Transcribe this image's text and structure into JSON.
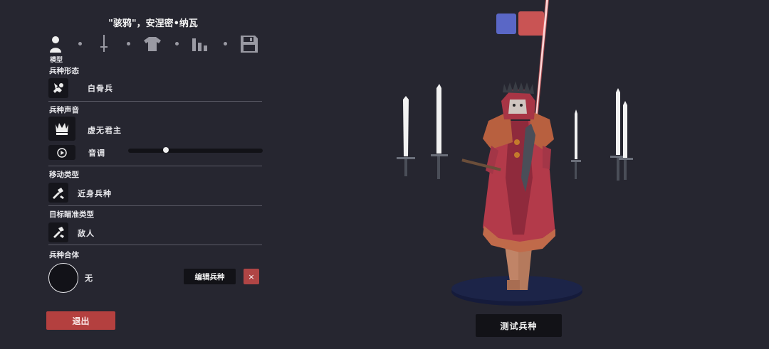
{
  "header": {
    "unit_name": "\"骇鸦\"，安涅密•纳瓦"
  },
  "tabs": {
    "active_label": "模型",
    "items": [
      {
        "icon": "person-icon"
      },
      {
        "icon": "sword-icon"
      },
      {
        "icon": "shirt-icon"
      },
      {
        "icon": "stats-bars-icon"
      },
      {
        "icon": "save-disk-icon"
      }
    ]
  },
  "sections": {
    "unit_base": {
      "label": "兵种形态",
      "value": "白骨兵",
      "icon": "skeleton-icon"
    },
    "unit_voice": {
      "label": "兵种声音",
      "value": "虚无君主",
      "icon": "crown-icon",
      "pitch_label": "音调",
      "pitch_level": 0.28
    },
    "movement": {
      "label": "移动类型",
      "value": "近身兵种",
      "icon": "melee-icon"
    },
    "targeting": {
      "label": "目标瞄准类型",
      "value": "敌人",
      "icon": "target-enemy-icon"
    },
    "mount": {
      "label": "兵种合体",
      "value": "无",
      "edit_label": "编辑兵种",
      "close_label": "×"
    }
  },
  "buttons": {
    "exit": "退出",
    "test": "测试兵种"
  },
  "team_colors": {
    "blue": "#5a67c6",
    "red": "#c95454"
  }
}
